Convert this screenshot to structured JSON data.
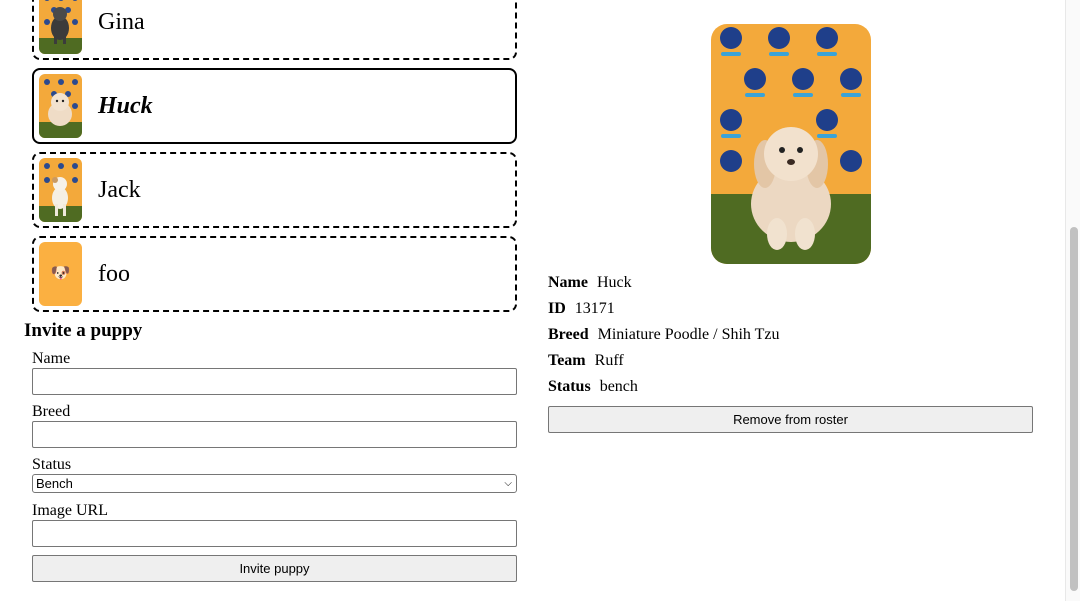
{
  "puppies": [
    {
      "name": "Gina",
      "selected": false
    },
    {
      "name": "Huck",
      "selected": true
    },
    {
      "name": "Jack",
      "selected": false
    },
    {
      "name": "foo",
      "selected": false,
      "placeholder_icon": "dog-face-icon"
    }
  ],
  "invite": {
    "title": "Invite a puppy",
    "name_label": "Name",
    "name_value": "",
    "breed_label": "Breed",
    "breed_value": "",
    "status_label": "Status",
    "status_value": "Bench",
    "image_url_label": "Image URL",
    "image_url_value": "",
    "submit_label": "Invite puppy"
  },
  "detail": {
    "name_label": "Name",
    "name": "Huck",
    "id_label": "ID",
    "id": "13171",
    "breed_label": "Breed",
    "breed": "Miniature Poodle / Shih Tzu",
    "team_label": "Team",
    "team": "Ruff",
    "status_label": "Status",
    "status": "bench",
    "remove_label": "Remove from roster"
  },
  "colors": {
    "backdrop": "#f3a93b",
    "grass": "#4f6b22",
    "placeholder_bg": "#fbb041",
    "logo_blue": "#1f3f8a"
  }
}
